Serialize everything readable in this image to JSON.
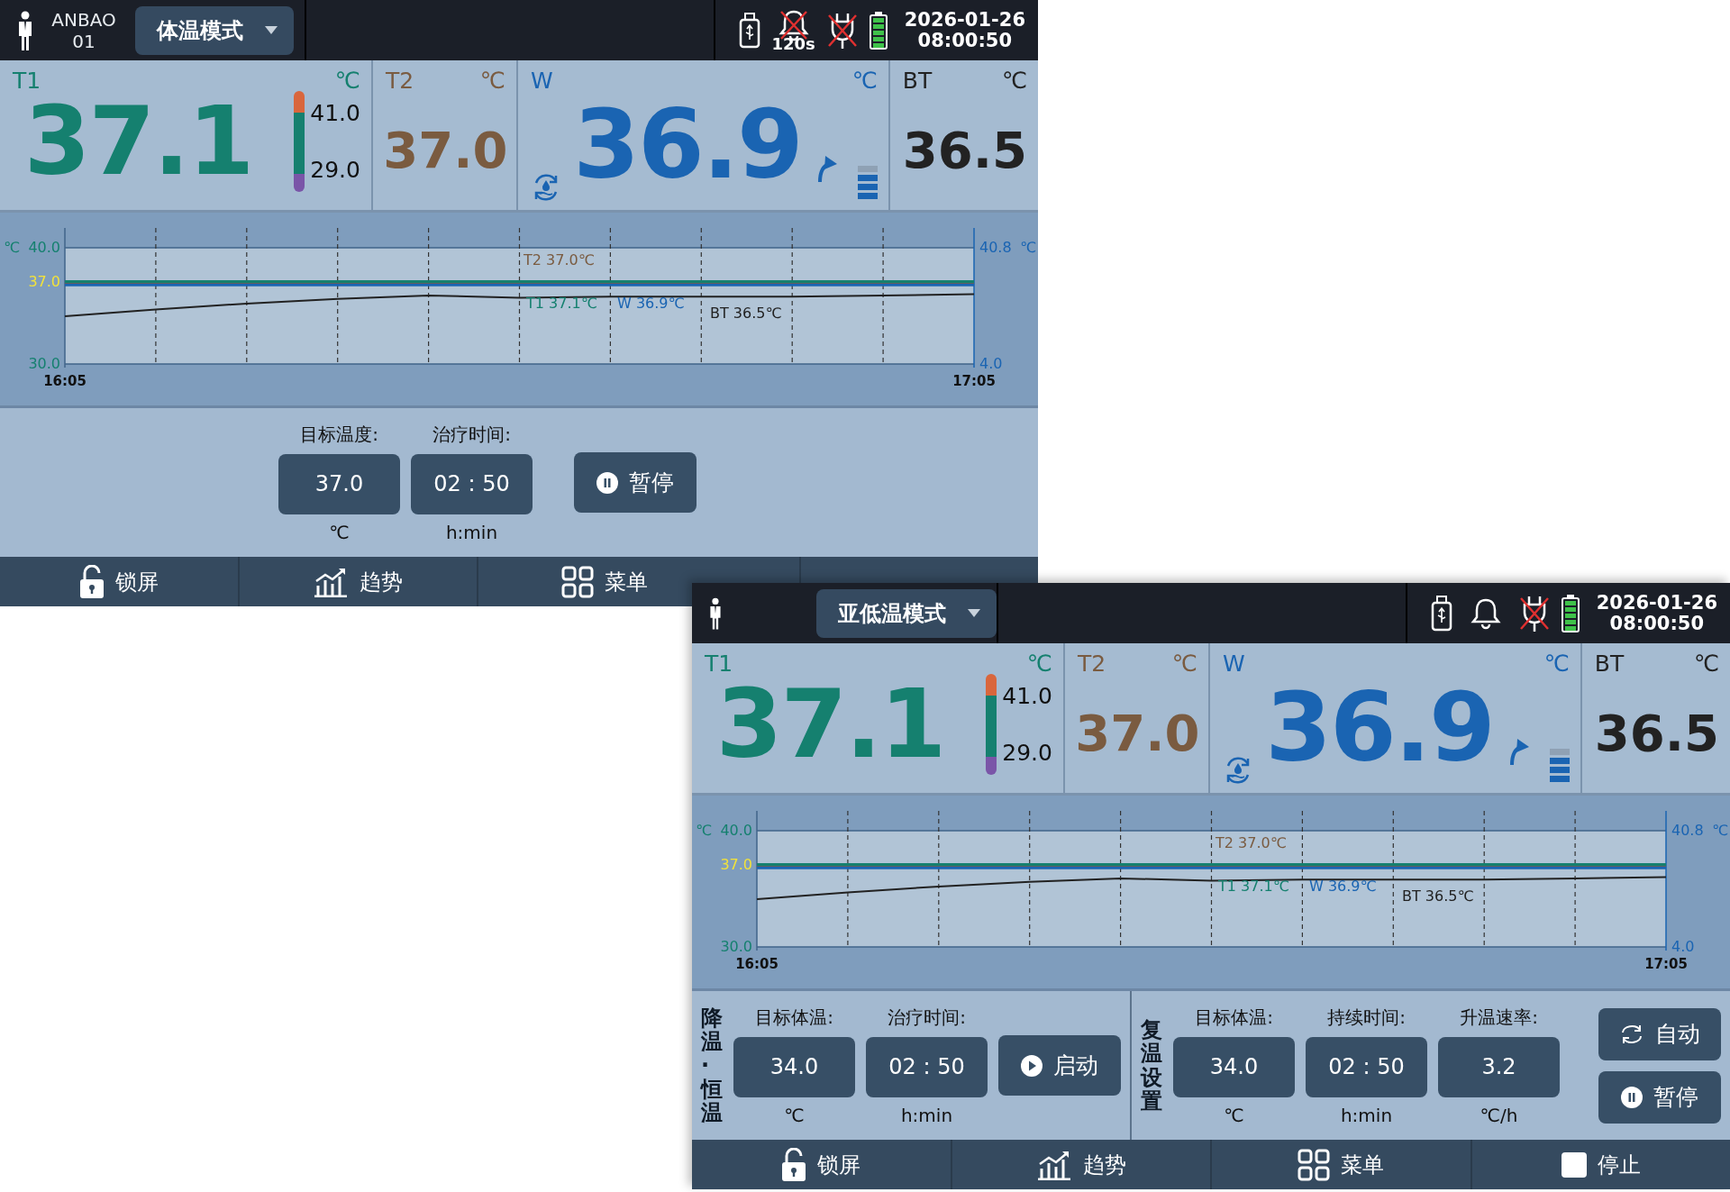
{
  "screens": [
    {
      "header": {
        "device_name": "ANBAO",
        "device_number": "01",
        "mode": "体温模式",
        "alarm": {
          "muted": true,
          "timer": "120s"
        },
        "power_disconnected": true,
        "date": "2026-01-26",
        "time": "08:00:50"
      },
      "readings": [
        {
          "kind": "t1",
          "label": "T1",
          "unit": "℃",
          "value": "37.1",
          "color": "#15806f",
          "scale_high": "41.0",
          "scale_low": "29.0"
        },
        {
          "kind": "plain",
          "label": "T2",
          "unit": "℃",
          "value": "37.0",
          "color": "#7a5b40"
        },
        {
          "kind": "water",
          "label": "W",
          "unit": "℃",
          "value": "36.9",
          "color": "#1a64b2",
          "rising": true,
          "level": 0.75
        },
        {
          "kind": "plain",
          "label": "BT",
          "unit": "℃",
          "value": "36.5",
          "color": "#222222"
        }
      ],
      "chart_data": {
        "type": "line",
        "ylabel": "℃",
        "categories": [
          "16:05",
          null,
          null,
          null,
          null,
          null,
          null,
          null,
          null,
          null,
          "17:05"
        ],
        "ylim": [
          30,
          40
        ],
        "yticks": [
          {
            "value": 40,
            "label": "40.0"
          },
          {
            "value": 37,
            "label": "37.0"
          },
          {
            "value": 30,
            "label": "30.0"
          }
        ],
        "y2label": "℃",
        "y2ticks": [
          "40.8",
          "4.0"
        ],
        "series": [
          {
            "color": "#7a5b40",
            "values": [
              37.0,
              37.0,
              37.0,
              37.0,
              37.0,
              37.0,
              37.0,
              37.0,
              37.0,
              37.0,
              37.0
            ]
          },
          {
            "color": "#15806f",
            "values": [
              37.1,
              37.1,
              37.1,
              37.1,
              37.1,
              37.1,
              37.1,
              37.1,
              37.1,
              37.1,
              37.1
            ]
          },
          {
            "color": "#1a64b2",
            "values": [
              36.8,
              36.8,
              36.8,
              36.8,
              36.8,
              36.8,
              36.8,
              36.8,
              36.8,
              36.8,
              36.8
            ]
          },
          {
            "color": "#222222",
            "values": [
              34.1,
              34.7,
              35.2,
              35.6,
              35.9,
              35.7,
              35.8,
              35.8,
              35.8,
              35.9,
              36.0
            ]
          }
        ],
        "annotations": [
          "T2 37.0℃",
          "T1 37.1℃",
          "W 36.9℃",
          "BT 36.5℃"
        ],
        "grid": true
      },
      "controls": [
        {
          "fields": [
            {
              "label": "目标温度:",
              "value": "37.0",
              "unit": "℃"
            },
            {
              "label": "治疗时间:",
              "value": "02 : 50",
              "unit": "h:min"
            }
          ],
          "buttons": [
            {
              "kind": "pause",
              "label": "暂停"
            }
          ]
        }
      ],
      "nav": [
        {
          "kind": "lock",
          "label": "锁屏"
        },
        {
          "kind": "trend",
          "label": "趋势"
        },
        {
          "kind": "menu",
          "label": "菜单"
        }
      ]
    },
    {
      "header": {
        "mode": "亚低温模式",
        "alarm": {
          "muted": false
        },
        "power_disconnected": true,
        "date": "2026-01-26",
        "time": "08:00:50"
      },
      "readings": [
        {
          "kind": "t1",
          "label": "T1",
          "unit": "℃",
          "value": "37.1",
          "color": "#15806f",
          "scale_high": "41.0",
          "scale_low": "29.0"
        },
        {
          "kind": "plain",
          "label": "T2",
          "unit": "℃",
          "value": "37.0",
          "color": "#7a5b40"
        },
        {
          "kind": "water",
          "label": "W",
          "unit": "℃",
          "value": "36.9",
          "color": "#1a64b2",
          "rising": true,
          "level": 0.75
        },
        {
          "kind": "plain",
          "label": "BT",
          "unit": "℃",
          "value": "36.5",
          "color": "#222222"
        }
      ],
      "chart_data": {
        "type": "line",
        "ylabel": "℃",
        "categories": [
          "16:05",
          null,
          null,
          null,
          null,
          null,
          null,
          null,
          null,
          null,
          "17:05"
        ],
        "ylim": [
          30,
          40
        ],
        "yticks": [
          {
            "value": 40,
            "label": "40.0"
          },
          {
            "value": 37,
            "label": "37.0"
          },
          {
            "value": 30,
            "label": "30.0"
          }
        ],
        "y2label": "℃",
        "y2ticks": [
          "40.8",
          "4.0"
        ],
        "series": [
          {
            "color": "#7a5b40",
            "values": [
              37.0,
              37.0,
              37.0,
              37.0,
              37.0,
              37.0,
              37.0,
              37.0,
              37.0,
              37.0,
              37.0
            ]
          },
          {
            "color": "#15806f",
            "values": [
              37.1,
              37.1,
              37.1,
              37.1,
              37.1,
              37.1,
              37.1,
              37.1,
              37.1,
              37.1,
              37.1
            ]
          },
          {
            "color": "#1a64b2",
            "values": [
              36.8,
              36.8,
              36.8,
              36.8,
              36.8,
              36.8,
              36.8,
              36.8,
              36.8,
              36.8,
              36.8
            ]
          },
          {
            "color": "#222222",
            "values": [
              34.1,
              34.7,
              35.2,
              35.6,
              35.9,
              35.7,
              35.8,
              35.8,
              35.8,
              35.9,
              36.0
            ]
          }
        ],
        "annotations": [
          "T2 37.0℃",
          "T1 37.1℃",
          "W 36.9℃",
          "BT 36.5℃"
        ],
        "grid": true
      },
      "controls": [
        {
          "title": "降温·恒温",
          "fields": [
            {
              "label": "目标体温:",
              "value": "34.0",
              "unit": "℃"
            },
            {
              "label": "治疗时间:",
              "value": "02 : 50",
              "unit": "h:min"
            }
          ],
          "buttons": [
            {
              "kind": "play",
              "label": "启动"
            }
          ]
        },
        {
          "title": "复温设置",
          "fields": [
            {
              "label": "目标体温:",
              "value": "34.0",
              "unit": "℃"
            },
            {
              "label": "持续时间:",
              "value": "02 : 50",
              "unit": "h:min"
            },
            {
              "label": "升温速率:",
              "value": "3.2",
              "unit": "℃/h"
            }
          ],
          "buttons": [
            {
              "kind": "auto",
              "label": "自动"
            },
            {
              "kind": "pause",
              "label": "暂停"
            }
          ]
        }
      ],
      "nav": [
        {
          "kind": "lock",
          "label": "锁屏"
        },
        {
          "kind": "trend",
          "label": "趋势"
        },
        {
          "kind": "menu",
          "label": "菜单"
        },
        {
          "kind": "stop",
          "label": "停止"
        }
      ]
    }
  ]
}
